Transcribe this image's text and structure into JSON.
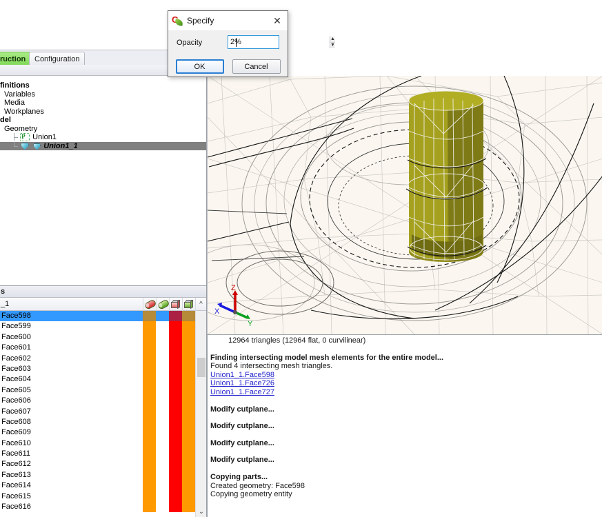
{
  "tabs": [
    {
      "label": "ruction",
      "active": true
    },
    {
      "label": "Configuration",
      "active": false
    }
  ],
  "tree": {
    "items": [
      {
        "label": "finitions",
        "bold": true,
        "indent": 0,
        "icon": "none"
      },
      {
        "label": "Variables",
        "bold": false,
        "indent": 1,
        "icon": "none"
      },
      {
        "label": "Media",
        "bold": false,
        "indent": 1,
        "icon": "none"
      },
      {
        "label": "Workplanes",
        "bold": false,
        "indent": 1,
        "icon": "none"
      },
      {
        "label": "del",
        "bold": true,
        "indent": 0,
        "icon": "none"
      },
      {
        "label": "Geometry",
        "bold": false,
        "indent": 1,
        "icon": "none"
      },
      {
        "label": "Union1",
        "bold": false,
        "indent": 2,
        "icon": "parameter-icon"
      },
      {
        "label": "Union1_1",
        "bold": false,
        "indent": 2,
        "icon": "geometry-gem-icon",
        "selected": true
      }
    ]
  },
  "faces": {
    "panel_title": "s",
    "column_name": "_1",
    "columns": [
      {
        "name": "transparency-red-icon"
      },
      {
        "name": "transparency-green-icon"
      },
      {
        "name": "solid-red-cube-icon"
      },
      {
        "name": "solid-green-cube-icon"
      }
    ],
    "rows": [
      {
        "label": "Face598",
        "selected": true,
        "c1": "orange",
        "c2": "none",
        "c3": "red",
        "c4": "orange"
      },
      {
        "label": "Face599",
        "selected": false,
        "c1": "orange",
        "c2": "none",
        "c3": "red",
        "c4": "orange"
      },
      {
        "label": "Face600",
        "selected": false,
        "c1": "orange",
        "c2": "none",
        "c3": "red",
        "c4": "orange"
      },
      {
        "label": "Face601",
        "selected": false,
        "c1": "orange",
        "c2": "none",
        "c3": "red",
        "c4": "orange"
      },
      {
        "label": "Face602",
        "selected": false,
        "c1": "orange",
        "c2": "none",
        "c3": "red",
        "c4": "orange"
      },
      {
        "label": "Face603",
        "selected": false,
        "c1": "orange",
        "c2": "none",
        "c3": "red",
        "c4": "orange"
      },
      {
        "label": "Face604",
        "selected": false,
        "c1": "orange",
        "c2": "none",
        "c3": "red",
        "c4": "orange"
      },
      {
        "label": "Face605",
        "selected": false,
        "c1": "orange",
        "c2": "none",
        "c3": "red",
        "c4": "orange"
      },
      {
        "label": "Face606",
        "selected": false,
        "c1": "orange",
        "c2": "none",
        "c3": "red",
        "c4": "orange"
      },
      {
        "label": "Face607",
        "selected": false,
        "c1": "orange",
        "c2": "none",
        "c3": "red",
        "c4": "orange"
      },
      {
        "label": "Face608",
        "selected": false,
        "c1": "orange",
        "c2": "none",
        "c3": "red",
        "c4": "orange"
      },
      {
        "label": "Face609",
        "selected": false,
        "c1": "orange",
        "c2": "none",
        "c3": "red",
        "c4": "orange"
      },
      {
        "label": "Face610",
        "selected": false,
        "c1": "orange",
        "c2": "none",
        "c3": "red",
        "c4": "orange"
      },
      {
        "label": "Face611",
        "selected": false,
        "c1": "orange",
        "c2": "none",
        "c3": "red",
        "c4": "orange"
      },
      {
        "label": "Face612",
        "selected": false,
        "c1": "orange",
        "c2": "none",
        "c3": "red",
        "c4": "orange"
      },
      {
        "label": "Face613",
        "selected": false,
        "c1": "orange",
        "c2": "none",
        "c3": "red",
        "c4": "orange"
      },
      {
        "label": "Face614",
        "selected": false,
        "c1": "orange",
        "c2": "none",
        "c3": "red",
        "c4": "orange"
      },
      {
        "label": "Face615",
        "selected": false,
        "c1": "orange",
        "c2": "none",
        "c3": "red",
        "c4": "orange"
      },
      {
        "label": "Face616",
        "selected": false,
        "c1": "orange",
        "c2": "none",
        "c3": "red",
        "c4": "orange"
      }
    ]
  },
  "log": {
    "lines": [
      {
        "text": "12964 triangles (12964 flat, 0 curvilinear)",
        "style": "indent"
      },
      {
        "text": "",
        "style": "gap"
      },
      {
        "text": "Finding intersecting model mesh elements for the entire model...",
        "style": "head"
      },
      {
        "text": "Found 4 intersecting mesh triangles.",
        "style": "normal"
      },
      {
        "text": "Union1_1.Face598",
        "style": "link"
      },
      {
        "text": "Union1_1.Face726",
        "style": "link"
      },
      {
        "text": "Union1_1.Face727",
        "style": "link"
      },
      {
        "text": "",
        "style": "gap"
      },
      {
        "text": "Modify cutplane...",
        "style": "head"
      },
      {
        "text": "",
        "style": "gap"
      },
      {
        "text": "Modify cutplane...",
        "style": "head"
      },
      {
        "text": "",
        "style": "gap"
      },
      {
        "text": "Modify cutplane...",
        "style": "head"
      },
      {
        "text": "",
        "style": "gap"
      },
      {
        "text": "Modify cutplane...",
        "style": "head"
      },
      {
        "text": "",
        "style": "gap"
      },
      {
        "text": "Copying parts...",
        "style": "head"
      },
      {
        "text": "Created geometry: Face598",
        "style": "normal"
      },
      {
        "text": "Copying geometry entity",
        "style": "normal"
      }
    ]
  },
  "dialog": {
    "title": "Specify",
    "close_label": "✕",
    "opacity_label": "Opacity",
    "opacity_value": "2%",
    "spin_up": "▲",
    "spin_down": "▼",
    "ok_label": "OK",
    "cancel_label": "Cancel"
  },
  "viewport": {
    "axes": {
      "x": "X",
      "y": "Y",
      "z": "Z"
    },
    "colors": {
      "x_axis": "#2222dd",
      "y_axis": "#00aa22",
      "z_axis": "#dd0000",
      "solid": "#96921a",
      "background": "#fbf7f0"
    }
  }
}
